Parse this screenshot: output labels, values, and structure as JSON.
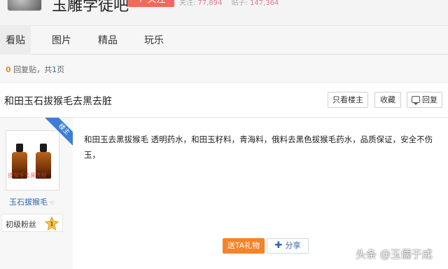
{
  "header": {
    "bar_name": "玉雕学徒吧",
    "follow_label": "+ 关注",
    "followers_label": "关注:",
    "followers_count": "77,894",
    "posts_label": "贴子:",
    "posts_count": "147,364"
  },
  "tabs": [
    "看贴",
    "图片",
    "精品",
    "玩乐"
  ],
  "reply_info": {
    "count": "0",
    "reply_label": "回复贴，共",
    "pages": "1",
    "page_unit": "页"
  },
  "thread": {
    "title": "和田玉石拔猴毛去黑去脏",
    "only_op_label": "只看楼主",
    "favorite_label": "收藏",
    "reply_label": "回复"
  },
  "post": {
    "op_badge": "楼主",
    "avatar_watermark": "拔猴毛去黑去脏",
    "user_name": "玉石拔猴毛",
    "level_title": "初级粉丝",
    "level_number": "1",
    "content": "和田玉去黑拔猴毛 透明药水，和田玉籽料，青海料，俄料去黑色拔猴毛药水，品质保证，安全不伤玉，",
    "gift_label": "送TA礼物",
    "share_label": "分享"
  },
  "watermark": "头条 @玉儒于成",
  "colors": {
    "follow": "#f3685c",
    "link_blue": "#2d64b3",
    "gift_orange": "#f5832a",
    "op_ribbon": "#3c7ed6"
  }
}
